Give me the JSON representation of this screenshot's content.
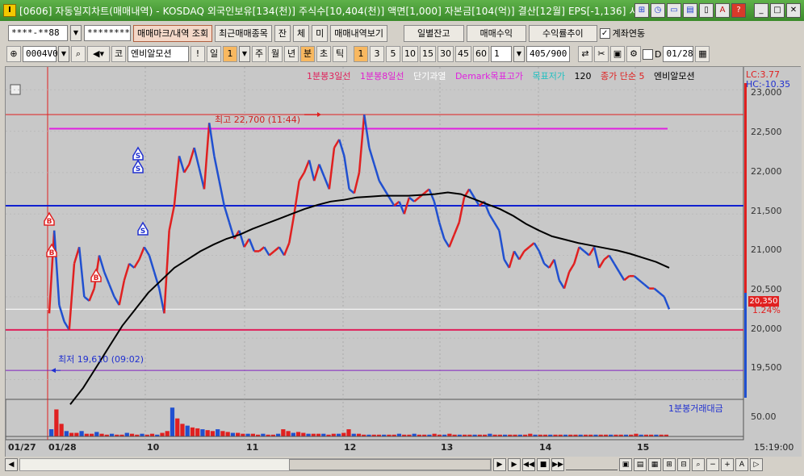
{
  "titlebar": {
    "title": "[0606] 자동일지차트(매매내역) - KOSDAQ 외국인보유[134(천)] 주식수[10,404(천)] 액면[1,000] 자본금[104(억)] 결산[12월] EPS[-1,136] 시가",
    "icon": "I"
  },
  "toolbar1": {
    "account": "****-**88",
    "password": "********",
    "btn_trade_mark": "매매마크/내역 조회",
    "btn_recent": "최근매매종목",
    "btn_jan": "잔",
    "btn_che": "체",
    "btn_mi": "미",
    "btn_trade_view": "매매내역보기",
    "btn_daily_balance": "일별잔고",
    "btn_trade_profit": "매매수익",
    "btn_profit_trend": "수익률추이",
    "account_link_label": "계좌연동",
    "account_link_checked": "✓"
  },
  "toolbar2": {
    "code": "0004V0",
    "ko": "코",
    "stock_name": "엔비알모션",
    "period_il": "일",
    "period_num": "1",
    "period_ju": "주",
    "period_wol": "월",
    "period_nyeon": "년",
    "period_bun": "분",
    "period_cho": "초",
    "period_tick": "틱",
    "min_1": "1",
    "min_3": "3",
    "min_5": "5",
    "min_10": "10",
    "min_15": "15",
    "min_30": "30",
    "min_45": "45",
    "min_60": "60",
    "custom_min": "1",
    "count": "405",
    "count_total": "/900",
    "d_label": "D",
    "date": "01/28"
  },
  "legend": {
    "items": [
      {
        "label": "1분봉3일선",
        "color": "#e0205a"
      },
      {
        "label": "1분봉8일선",
        "color": "#e020d0"
      },
      {
        "label": "단기과열",
        "color": "#ffffff"
      },
      {
        "label": "Demark목표고가",
        "color": "#e020e0"
      },
      {
        "label": "목표저가",
        "color": "#20c0c0"
      },
      {
        "label": "120",
        "color": "#000000"
      },
      {
        "label": "종가 단순 5",
        "color": "#e02020"
      },
      {
        "label": "엔비알모션",
        "color": "#000000"
      }
    ],
    "lc": "LC:3.77",
    "hc": "HC:-10.35",
    "volume_label": "1분봉거래대금"
  },
  "annotations": {
    "high": "최고 22,700 (11:44)",
    "low": "최저 19,610 (09:02)",
    "current_price": "20,350",
    "current_pct": "1.24%",
    "volume_tick": "50.00"
  },
  "y_axis": [
    "23,000",
    "22,500",
    "22,000",
    "21,500",
    "21,000",
    "20,500",
    "20,000",
    "19,500"
  ],
  "x_axis": [
    "01/27",
    "01/28",
    "10",
    "11",
    "12",
    "13",
    "14",
    "15"
  ],
  "time_label": "15:19:00",
  "chart_data": {
    "type": "line",
    "title": "엔비알모션",
    "ylim": [
      19300,
      23100
    ],
    "price": [
      20300,
      21300,
      20400,
      20200,
      20100,
      20900,
      21100,
      20500,
      20450,
      20600,
      21000,
      20800,
      20650,
      20500,
      20400,
      20700,
      20900,
      20850,
      20950,
      21100,
      21000,
      20800,
      20600,
      20300,
      21300,
      21600,
      22200,
      22000,
      22100,
      22300,
      22050,
      21800,
      22600,
      22200,
      21900,
      21600,
      21400,
      21200,
      21300,
      21100,
      21200,
      21050,
      21050,
      21100,
      21000,
      21050,
      21100,
      21000,
      21150,
      21500,
      21900,
      22000,
      22150,
      21900,
      22100,
      21950,
      21800,
      22300,
      22400,
      22200,
      21800,
      21750,
      22000,
      22700,
      22300,
      22100,
      21900,
      21800,
      21700,
      21600,
      21650,
      21500,
      21700,
      21650,
      21700,
      21750,
      21800,
      21650,
      21400,
      21200,
      21100,
      21250,
      21400,
      21700,
      21800,
      21700,
      21600,
      21650,
      21500,
      21400,
      21300,
      20950,
      20850,
      21050,
      20950,
      21050,
      21100,
      21150,
      21050,
      20900,
      20850,
      20950,
      20700,
      20600,
      20800,
      20900,
      21100,
      21050,
      21000,
      21100,
      20850,
      20950,
      21000,
      20900,
      20800,
      20700,
      20750,
      20750,
      20700,
      20650,
      20600,
      20600,
      20550,
      20500,
      20350
    ],
    "ma120": [
      19200,
      19400,
      19650,
      19900,
      20150,
      20350,
      20550,
      20700,
      20850,
      20950,
      21050,
      21130,
      21200,
      21250,
      21320,
      21380,
      21440,
      21500,
      21560,
      21610,
      21650,
      21670,
      21700,
      21710,
      21720,
      21720,
      21720,
      21730,
      21740,
      21760,
      21740,
      21680,
      21620,
      21560,
      21480,
      21380,
      21300,
      21230,
      21190,
      21150,
      21120,
      21090,
      21060,
      21020,
      20970,
      20920,
      20850
    ],
    "volume": [
      8,
      30,
      14,
      6,
      4,
      4,
      6,
      3,
      3,
      5,
      3,
      2,
      3,
      2,
      2,
      4,
      3,
      2,
      3,
      2,
      3,
      2,
      4,
      6,
      32,
      20,
      14,
      12,
      10,
      9,
      8,
      7,
      6,
      8,
      6,
      5,
      4,
      4,
      3,
      3,
      3,
      2,
      3,
      2,
      2,
      3,
      8,
      6,
      4,
      5,
      4,
      3,
      3,
      3,
      3,
      2,
      3,
      3,
      4,
      8,
      3,
      3,
      2,
      2,
      2,
      2,
      2,
      2,
      2,
      3,
      2,
      2,
      3,
      2,
      2,
      2,
      3,
      2,
      2,
      3,
      2,
      2,
      2,
      2,
      2,
      2,
      2,
      3,
      2,
      2,
      2,
      2,
      2,
      2,
      2,
      3,
      2,
      2,
      2,
      2,
      2,
      2,
      2,
      2,
      2,
      2,
      2,
      2,
      2,
      2,
      2,
      2,
      2,
      2,
      2,
      2,
      3,
      2,
      2,
      2,
      2,
      2,
      2
    ]
  }
}
